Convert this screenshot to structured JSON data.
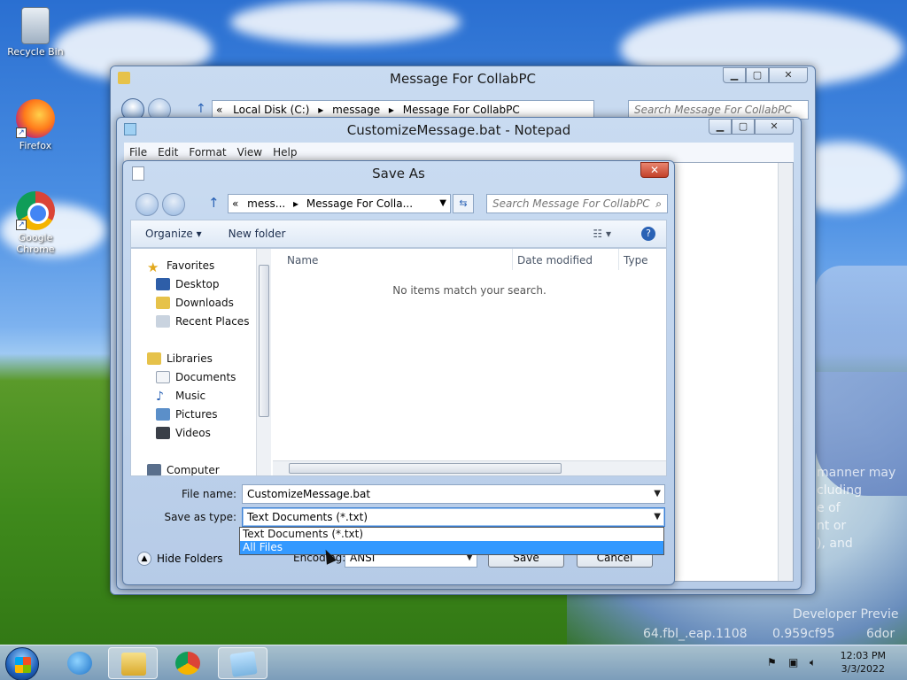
{
  "desktop": {
    "icons": [
      {
        "label": "Recycle Bin",
        "icon": "recycle-bin-icon"
      },
      {
        "label": "Firefox",
        "icon": "firefox-icon"
      },
      {
        "label": "Google Chrome",
        "icon": "chrome-icon"
      }
    ],
    "overlay_text": [
      "manner may",
      "cluding",
      "e of",
      "nt or",
      "), and",
      "Developer Previe",
      "64.fbl_.eap.1108",
      "0.959cf95",
      "6dor"
    ]
  },
  "explorer": {
    "title": "Message For CollabPC",
    "address": {
      "prefix": "«",
      "segments": [
        "Local Disk (C:)",
        "message",
        "Message For CollabPC"
      ]
    },
    "search_placeholder": "Search Message For CollabPC"
  },
  "notepad": {
    "title": "CustomizeMessage.bat - Notepad",
    "menu": [
      "File",
      "Edit",
      "Format",
      "View",
      "Help"
    ]
  },
  "save_as": {
    "title": "Save As",
    "close_label": "✕",
    "address": {
      "prefix": "«",
      "segments": [
        "mess...",
        "Message For Colla..."
      ]
    },
    "search_placeholder": "Search Message For CollabPC",
    "toolbar": {
      "organize": "Organize ▾",
      "new_folder": "New folder"
    },
    "nav": {
      "favorites": "Favorites",
      "desktop": "Desktop",
      "downloads": "Downloads",
      "recent": "Recent Places",
      "libraries": "Libraries",
      "documents": "Documents",
      "music": "Music",
      "pictures": "Pictures",
      "videos": "Videos",
      "computer": "Computer"
    },
    "columns": {
      "name": "Name",
      "date_modified": "Date modified",
      "type": "Type"
    },
    "empty_message": "No items match your search.",
    "file_name_label": "File name:",
    "file_name_value": "CustomizeMessage.bat",
    "save_type_label": "Save as type:",
    "save_type_value": "Text Documents (*.txt)",
    "save_type_options": [
      "Text Documents (*.txt)",
      "All Files"
    ],
    "save_type_selected_option": "All Files",
    "encoding_label": "Encoding:",
    "encoding_value": "ANSI",
    "hide_folders": "Hide Folders",
    "save_button": "Save",
    "cancel_button": "Cancel"
  },
  "taskbar": {
    "pinned": [
      "internet-explorer-icon",
      "file-explorer-icon",
      "chrome-icon",
      "notepad-icon"
    ],
    "clock_time": "12:03 PM",
    "clock_date": "3/3/2022"
  },
  "colors": {
    "selection": "#3399ff",
    "close_red": "#c2412a",
    "accent_blue": "#3c7fd3"
  }
}
